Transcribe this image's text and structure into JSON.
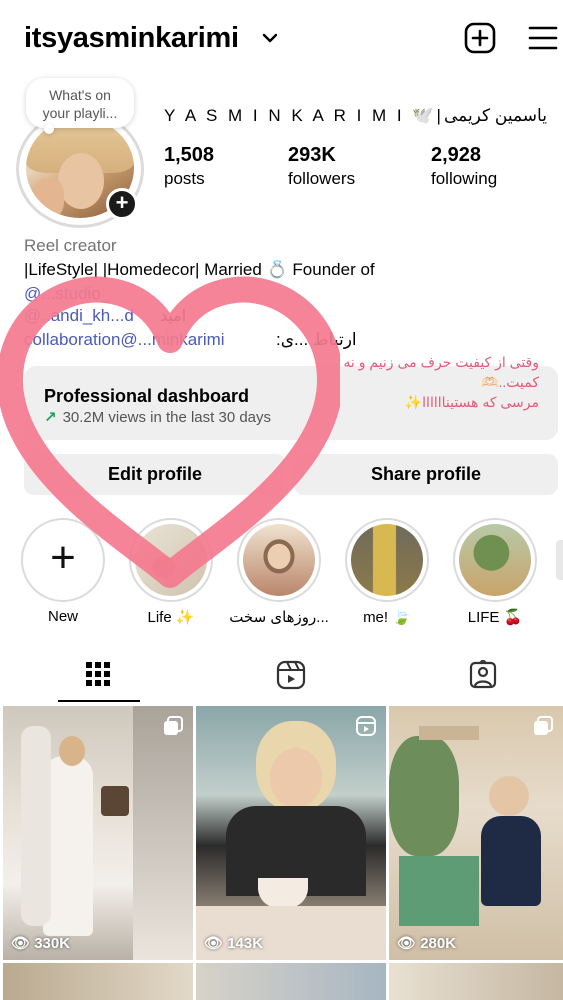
{
  "header": {
    "username": "itsyasminkarimi",
    "chevron_icon": "chevron-down-icon",
    "add_icon": "plus-square-icon",
    "menu_icon": "hamburger-menu-icon"
  },
  "note": {
    "text_line1": "What's on",
    "text_line2": "your playli..."
  },
  "profile": {
    "display_name": "Y A S M I N  K A R I M I 🕊️|یاسمین کریمی",
    "stats": [
      {
        "value": "1,508",
        "label": "posts"
      },
      {
        "value": "293K",
        "label": "followers"
      },
      {
        "value": "2,928",
        "label": "following"
      }
    ]
  },
  "bio": {
    "category": "Reel creator",
    "line1": "|LifeStyle| |Homedecor|   Married 💍 Founder of",
    "link1": "@...studio_",
    "link2": "@..andi_kh...d",
    "fa_fragment": "امید",
    "contact_link": "collaboration@...minkarimi",
    "contact_label": ":ارتباط ...ی"
  },
  "dashboard": {
    "title": "Professional dashboard",
    "subtitle": "30.2M views in the last 30 days",
    "arrow_icon": "trend-up-arrow-icon",
    "overlay_note_line1": "وقتی از کیفیت حرف می زنیم و نه",
    "overlay_note_line2": "کمیت..🫶🏻",
    "overlay_note_line3": "مرسی که هستیناااااا✨"
  },
  "buttons": {
    "edit": "Edit profile",
    "share": "Share profile"
  },
  "highlights": [
    {
      "label": "New",
      "kind": "new"
    },
    {
      "label": "Life ✨",
      "kind": "image",
      "colors": [
        "#e9e3d7",
        "#cfc3ae"
      ]
    },
    {
      "label": "روزهای سخت...",
      "kind": "image",
      "colors": [
        "#f0e2cf",
        "#b9866a"
      ]
    },
    {
      "label": "me! 🍃",
      "kind": "image",
      "colors": [
        "#8b7a4a",
        "#d8c07a"
      ]
    },
    {
      "label": "LIFE 🍒",
      "kind": "image",
      "colors": [
        "#7a9a5a",
        "#c9a36a"
      ]
    }
  ],
  "tabs": [
    {
      "name": "grid",
      "icon": "grid-icon"
    },
    {
      "name": "reels",
      "icon": "reels-icon"
    },
    {
      "name": "tagged",
      "icon": "tagged-person-icon"
    }
  ],
  "posts": [
    {
      "views": "330K",
      "badge": "multi-image-icon",
      "colors": [
        "#d7d0c6",
        "#f2ede6",
        "#6b6257"
      ]
    },
    {
      "views": "143K",
      "badge": "reels-icon",
      "colors": [
        "#8aa6a8",
        "#2b2b2b",
        "#d9c6ae"
      ]
    },
    {
      "views": "280K",
      "badge": "multi-image-icon",
      "colors": [
        "#d4c3a9",
        "#6fa37a",
        "#9b7f5e"
      ]
    }
  ],
  "overlay": {
    "heart_color": "#f47a8f"
  }
}
